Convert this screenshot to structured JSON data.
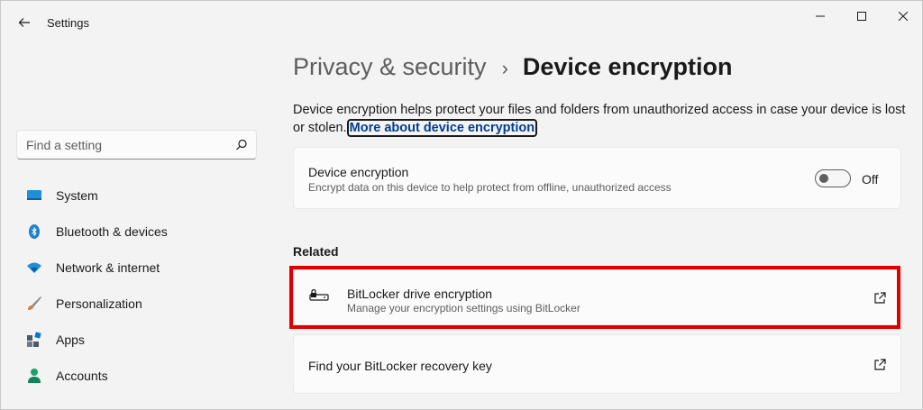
{
  "window": {
    "app_title": "Settings",
    "icons": {
      "back": "back-arrow-icon",
      "minimize": "minimize-icon",
      "maximize": "maximize-icon",
      "close": "close-icon"
    }
  },
  "search": {
    "placeholder": "Find a setting",
    "value": "",
    "icon": "search-icon"
  },
  "sidebar": {
    "items": [
      {
        "label": "System",
        "icon": "system-icon",
        "color": "#0078d4"
      },
      {
        "label": "Bluetooth & devices",
        "icon": "bluetooth-icon",
        "color": "#0078d4"
      },
      {
        "label": "Network & internet",
        "icon": "wifi-icon",
        "color": "#0078d4"
      },
      {
        "label": "Personalization",
        "icon": "brush-icon",
        "color": "#e07a3c"
      },
      {
        "label": "Apps",
        "icon": "apps-icon",
        "color": "#4a5a6a"
      },
      {
        "label": "Accounts",
        "icon": "person-icon",
        "color": "#1aa36b"
      }
    ]
  },
  "header": {
    "breadcrumb_parent": "Privacy & security",
    "breadcrumb_separator": "›",
    "title": "Device encryption"
  },
  "description": {
    "text": "Device encryption helps protect your files and folders from unauthorized access in case your device is lost or stolen.",
    "link": "More about device encryption"
  },
  "device_encryption_card": {
    "title": "Device encryption",
    "subtitle": "Encrypt data on this device to help protect from offline, unauthorized access",
    "toggle_state": "Off",
    "toggle_on": false
  },
  "related": {
    "label": "Related",
    "items": [
      {
        "title": "BitLocker drive encryption",
        "subtitle": "Manage your encryption settings using BitLocker",
        "icon": "bitlocker-drive-icon",
        "trailing_icon": "open-external-icon"
      },
      {
        "title": "Find your BitLocker recovery key",
        "trailing_icon": "open-external-icon"
      }
    ]
  },
  "colors": {
    "accent": "#0078d4",
    "highlight": "#e00000",
    "link": "#003e92"
  }
}
